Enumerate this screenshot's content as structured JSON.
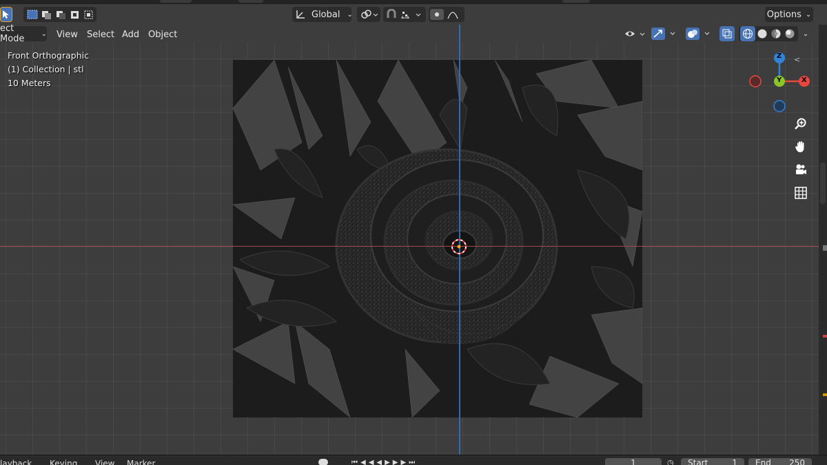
{
  "header": {
    "transform_orientation": "Global",
    "options_label": "Options"
  },
  "menu": {
    "mode": "ect Mode",
    "view": "View",
    "select": "Select",
    "add": "Add",
    "object": "Object"
  },
  "overlay": {
    "view_name": "Front Orthographic",
    "collection": "(1) Collection | stl",
    "scale": "10 Meters"
  },
  "gizmo": {
    "z_label": "Z",
    "y_label": "Y",
    "x_label": "X",
    "colors": {
      "x": "#e8473e",
      "y": "#8bc628",
      "z": "#2f83d9"
    }
  },
  "timeline": {
    "playback": "layback",
    "keying": "Keying",
    "view": "View",
    "marker": "Marker",
    "current_frame": "1",
    "start_label": "Start",
    "start_value": "1",
    "end_label": "End",
    "end_value": "250"
  },
  "icons": [
    "select-tool-icon",
    "select-box-icon",
    "transform-orientation-icon",
    "pivot-icon",
    "snap-icon",
    "proportional-edit-icon",
    "visibility-icon",
    "gizmo-icon",
    "overlay-icon",
    "xray-icon",
    "shading-wireframe-icon",
    "shading-solid-icon",
    "shading-material-icon",
    "shading-rendered-icon",
    "zoom-icon",
    "pan-hand-icon",
    "camera-icon",
    "grid-icon"
  ]
}
